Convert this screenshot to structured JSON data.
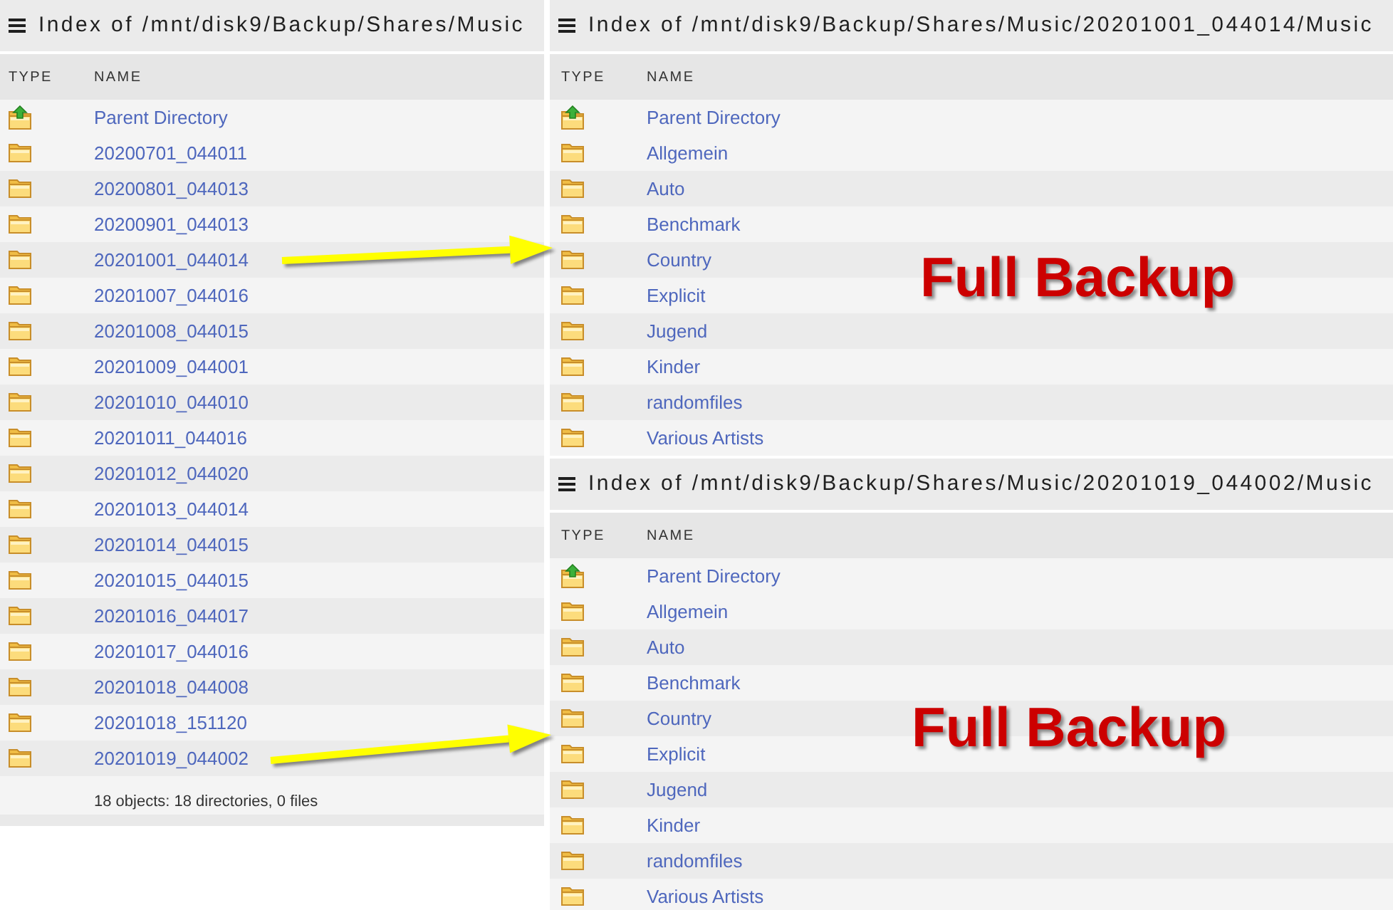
{
  "panels": [
    {
      "title": "Index of /mnt/disk9/Backup/Shares/Music",
      "columns": [
        "TYPE",
        "NAME"
      ],
      "rows": [
        {
          "kind": "parent",
          "name": "Parent Directory"
        },
        {
          "kind": "folder",
          "name": "20200701_044011"
        },
        {
          "kind": "folder",
          "name": "20200801_044013"
        },
        {
          "kind": "folder",
          "name": "20200901_044013"
        },
        {
          "kind": "folder",
          "name": "20201001_044014"
        },
        {
          "kind": "folder",
          "name": "20201007_044016"
        },
        {
          "kind": "folder",
          "name": "20201008_044015"
        },
        {
          "kind": "folder",
          "name": "20201009_044001"
        },
        {
          "kind": "folder",
          "name": "20201010_044010"
        },
        {
          "kind": "folder",
          "name": "20201011_044016"
        },
        {
          "kind": "folder",
          "name": "20201012_044020"
        },
        {
          "kind": "folder",
          "name": "20201013_044014"
        },
        {
          "kind": "folder",
          "name": "20201014_044015"
        },
        {
          "kind": "folder",
          "name": "20201015_044015"
        },
        {
          "kind": "folder",
          "name": "20201016_044017"
        },
        {
          "kind": "folder",
          "name": "20201017_044016"
        },
        {
          "kind": "folder",
          "name": "20201018_044008"
        },
        {
          "kind": "folder",
          "name": "20201018_151120"
        },
        {
          "kind": "folder",
          "name": "20201019_044002"
        }
      ],
      "footer": "18 objects: 18 directories, 0 files"
    },
    {
      "title": "Index of /mnt/disk9/Backup/Shares/Music/20201001_044014/Music",
      "columns": [
        "TYPE",
        "NAME"
      ],
      "rows": [
        {
          "kind": "parent",
          "name": "Parent Directory"
        },
        {
          "kind": "folder",
          "name": "Allgemein"
        },
        {
          "kind": "folder",
          "name": "Auto"
        },
        {
          "kind": "folder",
          "name": "Benchmark"
        },
        {
          "kind": "folder",
          "name": "Country"
        },
        {
          "kind": "folder",
          "name": "Explicit"
        },
        {
          "kind": "folder",
          "name": "Jugend"
        },
        {
          "kind": "folder",
          "name": "Kinder"
        },
        {
          "kind": "folder",
          "name": "randomfiles"
        },
        {
          "kind": "folder",
          "name": "Various Artists"
        }
      ]
    },
    {
      "title": "Index of /mnt/disk9/Backup/Shares/Music/20201019_044002/Music",
      "columns": [
        "TYPE",
        "NAME"
      ],
      "rows": [
        {
          "kind": "parent",
          "name": "Parent Directory"
        },
        {
          "kind": "folder",
          "name": "Allgemein"
        },
        {
          "kind": "folder",
          "name": "Auto"
        },
        {
          "kind": "folder",
          "name": "Benchmark"
        },
        {
          "kind": "folder",
          "name": "Country"
        },
        {
          "kind": "folder",
          "name": "Explicit"
        },
        {
          "kind": "folder",
          "name": "Jugend"
        },
        {
          "kind": "folder",
          "name": "Kinder"
        },
        {
          "kind": "folder",
          "name": "randomfiles"
        },
        {
          "kind": "folder",
          "name": "Various Artists"
        }
      ]
    }
  ],
  "callouts": [
    {
      "label": "Full Backup"
    },
    {
      "label": "Full Backup"
    }
  ]
}
